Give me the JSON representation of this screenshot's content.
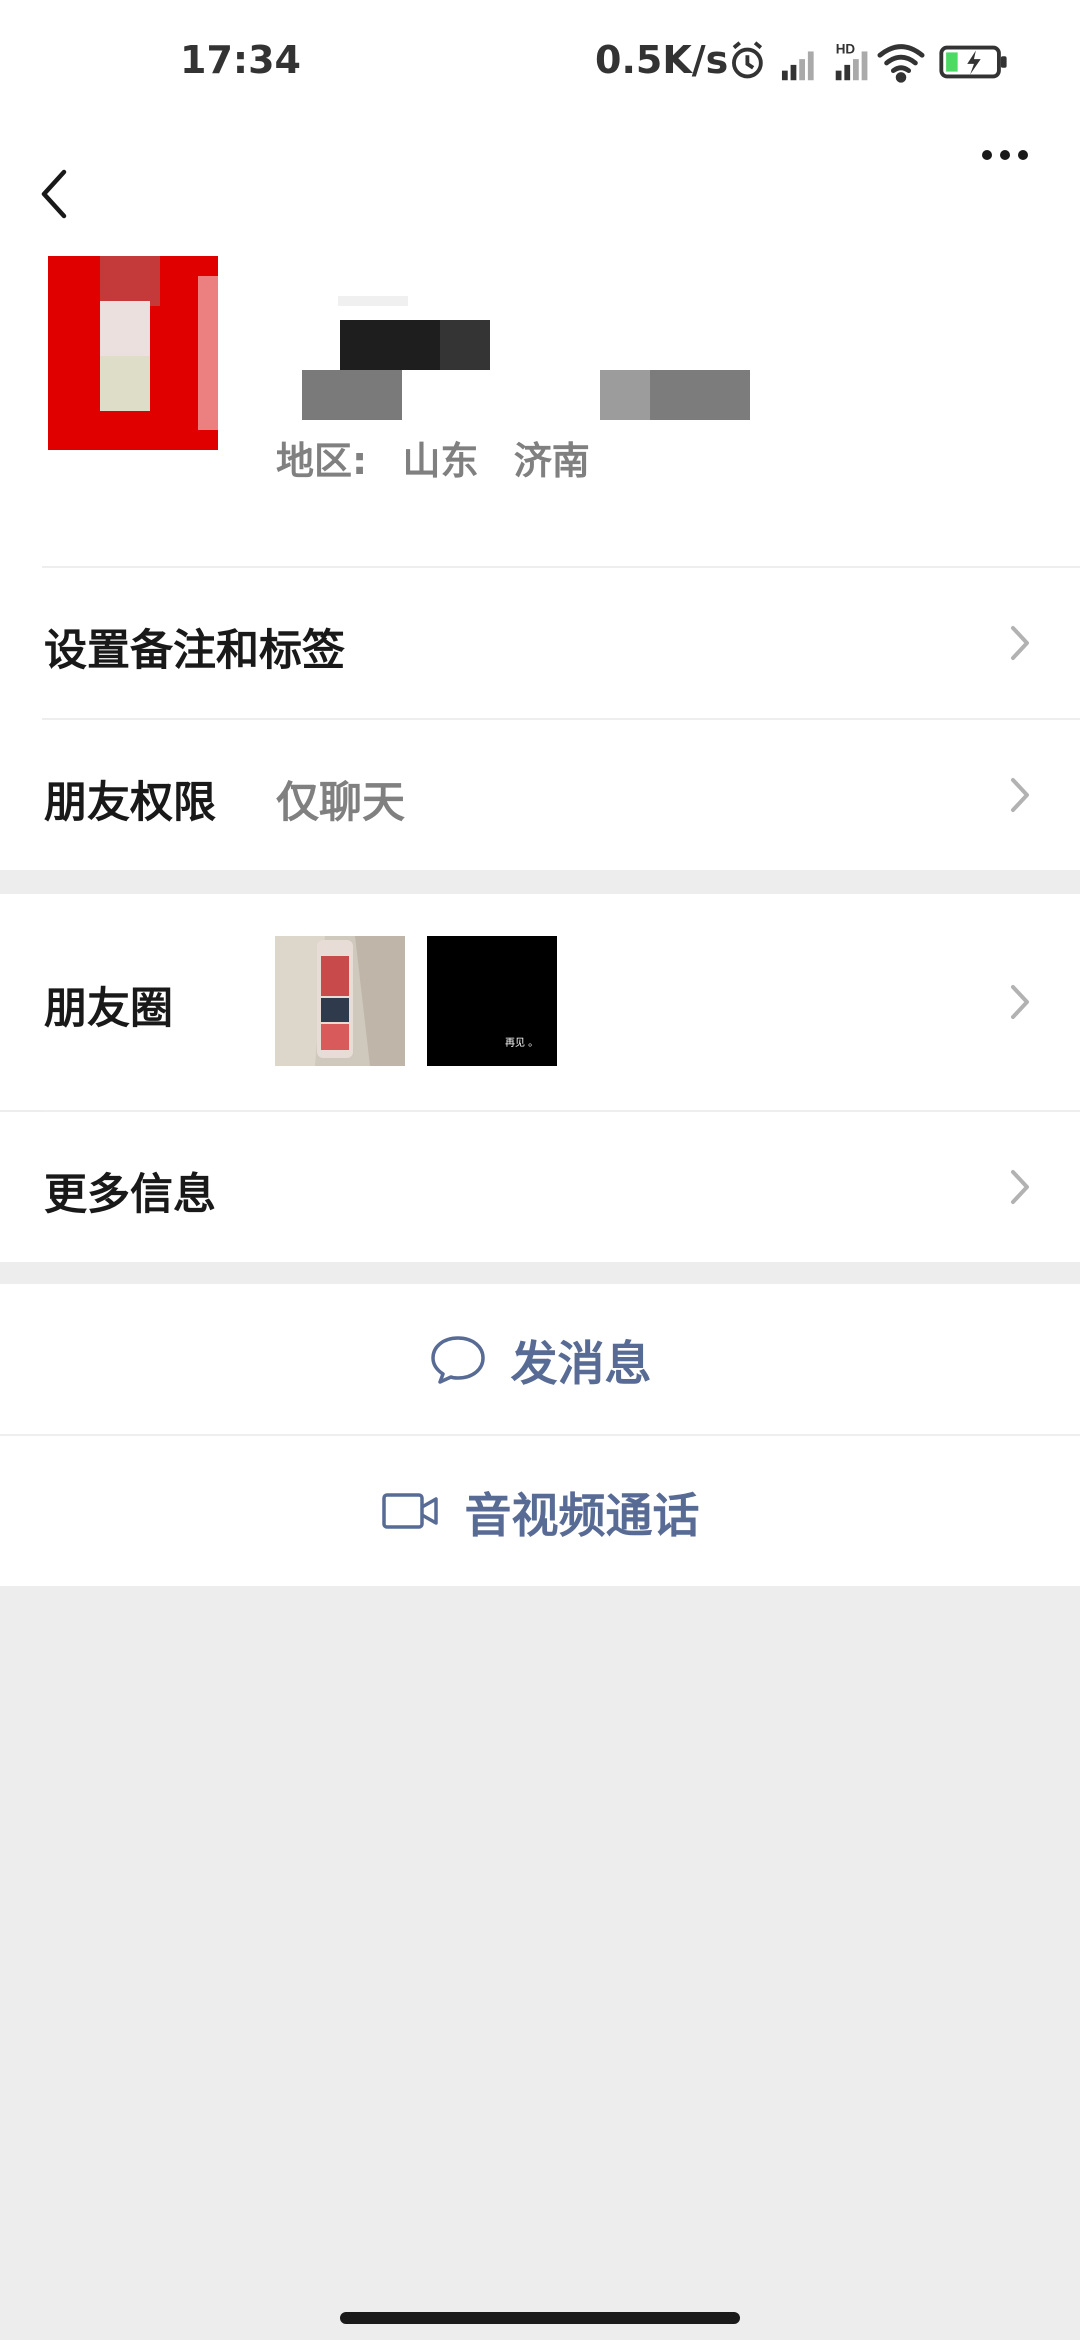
{
  "status_bar": {
    "time": "17:34",
    "net_speed": "0.5K/s",
    "icons": [
      "alarm-icon",
      "signal-icon",
      "hd-signal-icon",
      "wifi-icon",
      "battery-charging-icon"
    ]
  },
  "nav": {
    "back_icon": "chevron-left-icon",
    "more_icon": "more-dots-icon"
  },
  "profile": {
    "region_label": "地区:",
    "region_province": "山东",
    "region_city": "济南"
  },
  "rows": {
    "remark_tags": "设置备注和标签",
    "permission_label": "朋友权限",
    "permission_value": "仅聊天",
    "moments_label": "朋友圈",
    "moments_thumb_caption": "再见 。",
    "more_info": "更多信息"
  },
  "actions": {
    "message": "发消息",
    "av_call": "音视频通话"
  },
  "colors": {
    "link_blue": "#576b95",
    "page_bg": "#ededed",
    "card_bg": "#ffffff"
  }
}
